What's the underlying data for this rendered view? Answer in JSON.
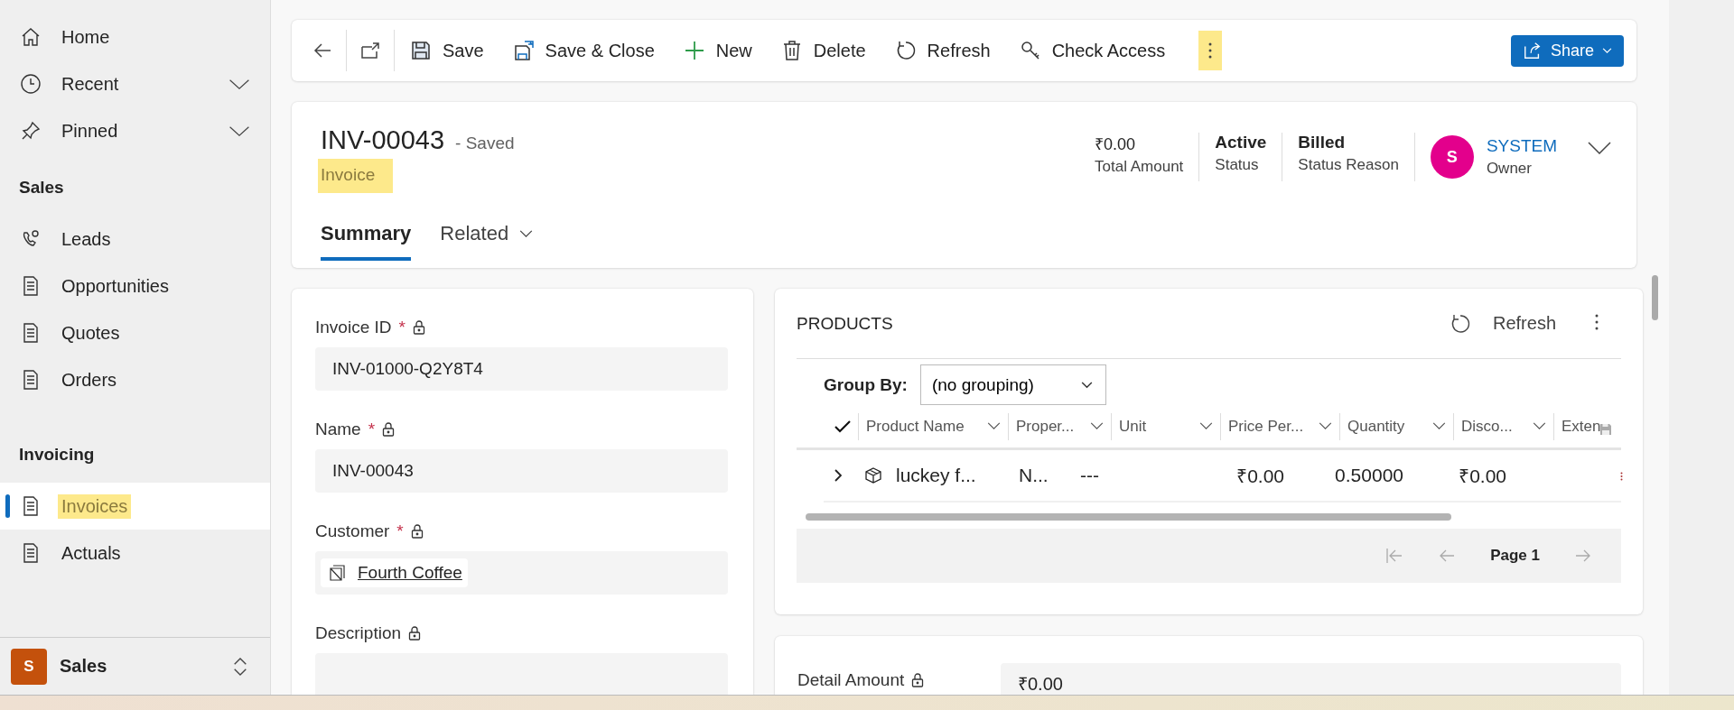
{
  "nav": [
    {
      "items": [
        {
          "label": "Home",
          "selected": false,
          "expandable": false,
          "highlighted": false
        },
        {
          "label": "Recent",
          "selected": false,
          "expandable": true,
          "highlighted": false
        },
        {
          "label": "Pinned",
          "selected": false,
          "expandable": true,
          "highlighted": false
        }
      ]
    },
    {
      "heading": "Sales",
      "items": [
        {
          "label": "Leads",
          "selected": false,
          "expandable": false,
          "highlighted": false
        },
        {
          "label": "Opportunities",
          "selected": false,
          "expandable": false,
          "highlighted": false
        },
        {
          "label": "Quotes",
          "selected": false,
          "expandable": false,
          "highlighted": false
        },
        {
          "label": "Orders",
          "selected": false,
          "expandable": false,
          "highlighted": false
        }
      ]
    },
    {
      "heading": "Invoicing",
      "items": [
        {
          "label": "Invoices",
          "selected": true,
          "expandable": false,
          "highlighted": true
        },
        {
          "label": "Actuals",
          "selected": false,
          "expandable": false,
          "highlighted": false
        }
      ]
    }
  ],
  "area_switcher": {
    "initial": "S",
    "label": "Sales"
  },
  "toolbar": {
    "buttons": [
      {
        "label": "Save"
      },
      {
        "label": "Save & Close"
      },
      {
        "label": "New"
      },
      {
        "label": "Delete"
      },
      {
        "label": "Refresh"
      },
      {
        "label": "Check Access"
      }
    ],
    "more_highlighted": true,
    "share": "Share"
  },
  "header": {
    "title": "INV-00043",
    "save_state": "- Saved",
    "entity": "Invoice",
    "entity_highlighted": true,
    "fields": [
      {
        "value": "₹0.00",
        "label": "Total Amount"
      },
      {
        "value": "Active",
        "label": "Status"
      },
      {
        "value": "Billed",
        "label": "Status Reason"
      }
    ],
    "owner": {
      "initial": "S",
      "name": "SYSTEM",
      "label": "Owner"
    },
    "tabs": [
      {
        "label": "Summary",
        "selected": true,
        "dropdown": false
      },
      {
        "label": "Related",
        "selected": false,
        "dropdown": true
      }
    ]
  },
  "form": {
    "fields": [
      {
        "label": "Invoice ID",
        "required_mark": "*",
        "kind": "text",
        "value": "INV-01000-Q2Y8T4"
      },
      {
        "label": "Name",
        "required_mark": "*",
        "kind": "text",
        "value": "INV-00043"
      },
      {
        "label": "Customer",
        "required_mark": "*",
        "kind": "lookup",
        "value": "Fourth Coffee"
      },
      {
        "label": "Description",
        "kind": "textarea"
      }
    ]
  },
  "products": {
    "title": "PRODUCTS",
    "refresh": "Refresh",
    "group_by_label": "Group By:",
    "group_by_value": "(no grouping)",
    "columns": [
      "Product Name",
      "Proper...",
      "Unit",
      "Price Per...",
      "Quantity",
      "Disco...",
      "Exten"
    ],
    "rows": [
      {
        "expanded": false,
        "cells": [
          "luckey f...",
          "N...",
          "---",
          "₹0.00",
          "0.50000",
          "₹0.00"
        ]
      }
    ],
    "page": "Page 1"
  },
  "detail": {
    "label": "Detail Amount",
    "value": "₹0.00"
  }
}
